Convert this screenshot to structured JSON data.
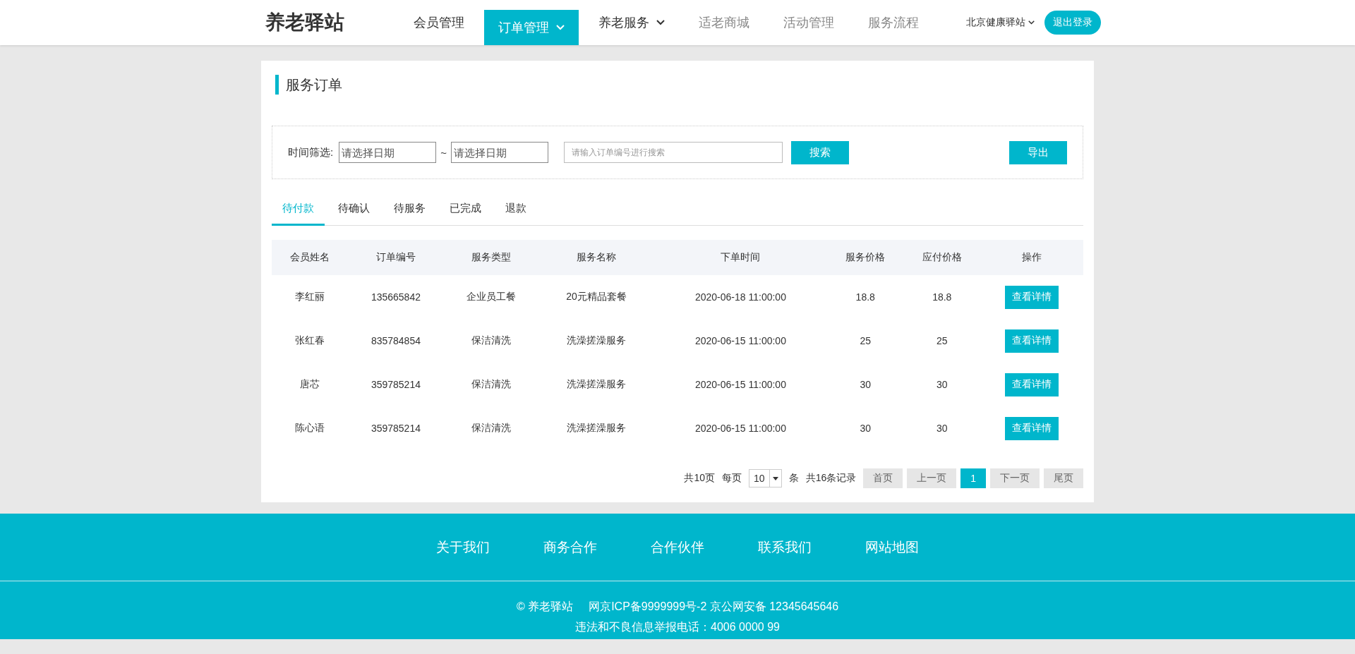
{
  "header": {
    "logo": "养老驿站",
    "nav": [
      {
        "label": "会员管理",
        "selected": false,
        "disabled": false,
        "dropdown": false
      },
      {
        "label": "订单管理",
        "selected": true,
        "disabled": false,
        "dropdown": true
      },
      {
        "label": "养老服务",
        "selected": false,
        "disabled": false,
        "dropdown": true
      },
      {
        "label": "适老商城",
        "selected": false,
        "disabled": true,
        "dropdown": false
      },
      {
        "label": "活动管理",
        "selected": false,
        "disabled": true,
        "dropdown": false
      },
      {
        "label": "服务流程",
        "selected": false,
        "disabled": true,
        "dropdown": false
      }
    ],
    "station": "北京健康驿站",
    "logout": "退出登录"
  },
  "page": {
    "title": "服务订单",
    "filter": {
      "label": "时间筛选:",
      "start_placeholder": "请选择日期",
      "separator": "~",
      "end_placeholder": "请选择日期",
      "search_placeholder": "请输入订单编号进行搜索",
      "search_button": "搜索",
      "export_button": "导出"
    },
    "tabs": [
      {
        "label": "待付款",
        "selected": true
      },
      {
        "label": "待确认",
        "selected": false
      },
      {
        "label": "待服务",
        "selected": false
      },
      {
        "label": "已完成",
        "selected": false
      },
      {
        "label": "退款",
        "selected": false
      }
    ],
    "table": {
      "columns": [
        "会员姓名",
        "订单编号",
        "服务类型",
        "服务名称",
        "下单时间",
        "服务价格",
        "应付价格",
        "操作"
      ],
      "rows": [
        {
          "cells": [
            "李红丽",
            "135665842",
            "企业员工餐",
            "20元精品套餐",
            "2020-06-18 11:00:00",
            "18.8",
            "18.8"
          ],
          "action": "查看详情"
        },
        {
          "cells": [
            "张红春",
            "835784854",
            "保洁清洗",
            "洗澡搓澡服务",
            "2020-06-15 11:00:00",
            "25",
            "25"
          ],
          "action": "查看详情"
        },
        {
          "cells": [
            "唐芯",
            "359785214",
            "保洁清洗",
            "洗澡搓澡服务",
            "2020-06-15 11:00:00",
            "30",
            "30"
          ],
          "action": "查看详情"
        },
        {
          "cells": [
            "陈心语",
            "359785214",
            "保洁清洗",
            "洗澡搓澡服务",
            "2020-06-15 11:00:00",
            "30",
            "30"
          ],
          "action": "查看详情"
        }
      ]
    },
    "pagination": {
      "total_pages": "共10页",
      "per_page_label": "每页",
      "per_page": "10",
      "unit": "条",
      "total_records": "共16条记录",
      "buttons": [
        {
          "label": "首页",
          "selected": false
        },
        {
          "label": "上一页",
          "selected": false
        },
        {
          "label": "1",
          "selected": true
        },
        {
          "label": "下一页",
          "selected": false
        },
        {
          "label": "尾页",
          "selected": false
        }
      ]
    }
  },
  "footer": {
    "links": [
      "关于我们",
      "商务合作",
      "合作伙伴",
      "联系我们",
      "网站地图"
    ],
    "copyright": "© 养老驿站",
    "icp": "网京ICP备9999999号-2 京公网安备 12345645646",
    "report": "违法和不良信息举报电话：4006 0000 99"
  }
}
